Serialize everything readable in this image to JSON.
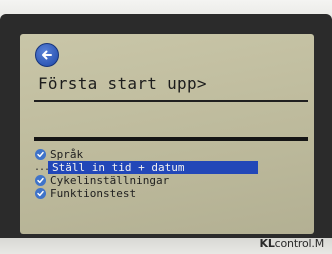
{
  "screen": {
    "back_icon": "back-arrow-icon",
    "title": "Första start upp>"
  },
  "menu": {
    "items": [
      {
        "label": "Språk",
        "status": "done",
        "icon": "check-icon"
      },
      {
        "label": "Ställ in tid + datum",
        "status": "selected",
        "marker": "..."
      },
      {
        "label": "Cykelinställningar",
        "status": "done",
        "icon": "check-icon"
      },
      {
        "label": "Funktionstest",
        "status": "done",
        "icon": "check-icon"
      }
    ]
  },
  "device": {
    "brand": "KLcontrol.M",
    "brand_bold": "KL",
    "brand_rest": "control.M"
  },
  "colors": {
    "lcd_background": "#c2bfa1",
    "highlight": "#2247b8",
    "check_icon": "#3f73c9",
    "back_button": "#1d47a8"
  }
}
